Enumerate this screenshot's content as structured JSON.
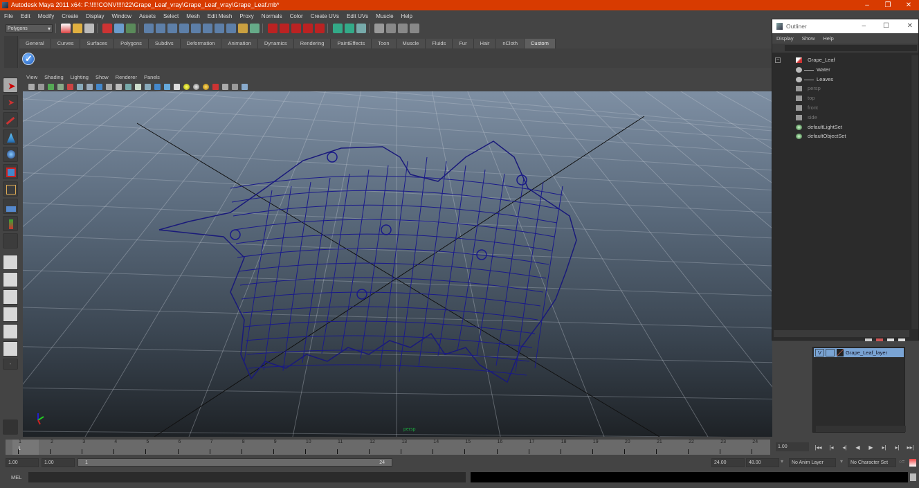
{
  "window": {
    "title": "Autodesk Maya 2011 x64: F:\\!!!!CONV!!!!\\22\\Grape_Leaf_vray\\Grape_Leaf_vray\\Grape_Leaf.mb*",
    "minimize": "–",
    "restore": "❐",
    "close": "✕"
  },
  "menubar": [
    "File",
    "Edit",
    "Modify",
    "Create",
    "Display",
    "Window",
    "Assets",
    "Select",
    "Mesh",
    "Edit Mesh",
    "Proxy",
    "Normals",
    "Color",
    "Create UVs",
    "Edit UVs",
    "Muscle",
    "Help"
  ],
  "status_line": {
    "mode_selector": "Polygons"
  },
  "shelf": {
    "tabs": [
      "General",
      "Curves",
      "Surfaces",
      "Polygons",
      "Subdivs",
      "Deformation",
      "Animation",
      "Dynamics",
      "Rendering",
      "PaintEffects",
      "Toon",
      "Muscle",
      "Fluids",
      "Fur",
      "Hair",
      "nCloth",
      "Custom"
    ],
    "active_tab": "Custom"
  },
  "toolbox": {
    "tools": [
      "select-tool",
      "lasso-tool",
      "paint-select-tool",
      "move-tool",
      "rotate-tool",
      "scale-tool",
      "universal-manipulator",
      "soft-mod-tool",
      "show-manipulator",
      "last-tool"
    ],
    "layouts": [
      "single-perspective",
      "four-view",
      "outliner-persp",
      "graph-persp",
      "hypershade-persp",
      "persp-graph-hypergraph"
    ]
  },
  "panel_menu": [
    "View",
    "Shading",
    "Lighting",
    "Show",
    "Renderer",
    "Panels"
  ],
  "viewport": {
    "camera_label": "persp",
    "axis_labels": {
      "x": "x",
      "y": "y",
      "z": "z"
    }
  },
  "outliner": {
    "title": "Outliner",
    "menu": [
      "Display",
      "Show",
      "Help"
    ],
    "items": [
      {
        "label": "Grape_Leaf",
        "icon": "transform-icon",
        "indent": 0,
        "expand": "−",
        "dim": false
      },
      {
        "label": "Water",
        "icon": "mesh-icon",
        "indent": 1,
        "dim": false
      },
      {
        "label": "Leaves",
        "icon": "mesh-icon",
        "indent": 1,
        "dim": false
      },
      {
        "label": "persp",
        "icon": "camera-icon",
        "indent": 0,
        "dim": true
      },
      {
        "label": "top",
        "icon": "camera-icon",
        "indent": 0,
        "dim": true
      },
      {
        "label": "front",
        "icon": "camera-icon",
        "indent": 0,
        "dim": true
      },
      {
        "label": "side",
        "icon": "camera-icon",
        "indent": 0,
        "dim": true
      },
      {
        "label": "defaultLightSet",
        "icon": "set-icon",
        "indent": 0,
        "dim": false
      },
      {
        "label": "defaultObjectSet",
        "icon": "set-icon",
        "indent": 0,
        "dim": false
      }
    ]
  },
  "layers": {
    "rows": [
      {
        "visible": "V",
        "name": "Grape_Leaf_layer",
        "color": "#7aa4d4"
      }
    ]
  },
  "timeline": {
    "ticks": [
      "1",
      "2",
      "3",
      "4",
      "5",
      "6",
      "7",
      "8",
      "9",
      "10",
      "11",
      "12",
      "13",
      "14",
      "15",
      "16",
      "17",
      "18",
      "19",
      "20",
      "21",
      "22",
      "23",
      "24"
    ],
    "current_frame": "1",
    "current_frame_field": "1.00"
  },
  "playback": {
    "buttons": [
      "|◂◂",
      "|◂",
      "◂|",
      "◀",
      "▶",
      "▸|",
      "▸|",
      "▸▸|"
    ]
  },
  "range": {
    "start_field": "1.00",
    "playback_start": "1.00",
    "slider_start": "1",
    "slider_end": "24",
    "playback_end": "24.00",
    "end_field": "48.00",
    "anim_layer": "No Anim Layer",
    "character_set": "No Character Set"
  },
  "command_line": {
    "label": "MEL",
    "input": "",
    "output": ""
  }
}
